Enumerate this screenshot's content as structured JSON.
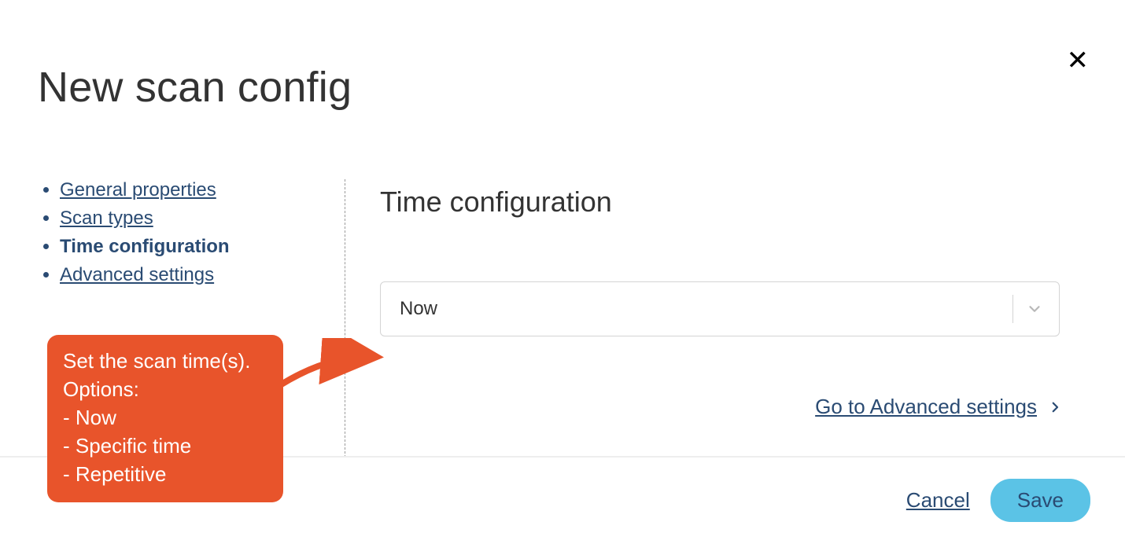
{
  "header": {
    "title": "New scan config"
  },
  "sidebar": {
    "items": [
      {
        "label": "General properties",
        "active": false
      },
      {
        "label": "Scan types",
        "active": false
      },
      {
        "label": "Time configuration",
        "active": true
      },
      {
        "label": "Advanced settings",
        "active": false
      }
    ]
  },
  "main": {
    "section_title": "Time configuration",
    "time_select_value": "Now",
    "next_link_label": "Go to Advanced settings"
  },
  "footer": {
    "cancel_label": "Cancel",
    "save_label": "Save"
  },
  "annotation": {
    "text": "Set the scan time(s). Options:\n- Now\n- Specific time\n- Repetitive"
  },
  "colors": {
    "link": "#2a4b73",
    "accent_button": "#5bc3e6",
    "annotation_bg": "#e8542b"
  }
}
